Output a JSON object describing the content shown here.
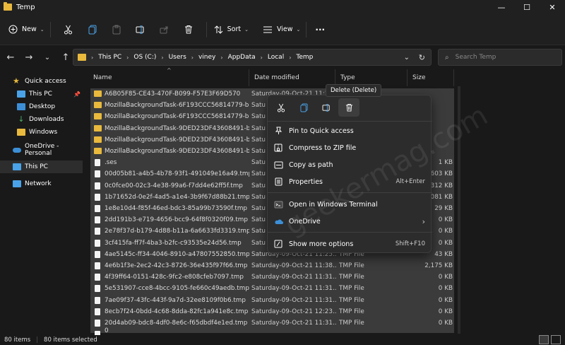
{
  "window": {
    "title": "Temp",
    "min": "—",
    "max": "☐",
    "close": "✕"
  },
  "toolbar": {
    "new_label": "New",
    "sort_label": "Sort",
    "view_label": "View",
    "more": "···"
  },
  "address": {
    "segments": [
      "This PC",
      "OS (C:)",
      "Users",
      "viney",
      "AppData",
      "Local",
      "Temp"
    ],
    "search_placeholder": "Search Temp"
  },
  "nav": {
    "items": [
      {
        "label": "Quick access",
        "icon": "star-icon"
      },
      {
        "label": "This PC",
        "icon": "pc-icon"
      },
      {
        "label": "Desktop",
        "icon": "desktop-icon"
      },
      {
        "label": "Downloads",
        "icon": "download-icon"
      },
      {
        "label": "Windows",
        "icon": "folder-icon"
      },
      {
        "label": "OneDrive - Personal",
        "icon": "cloud-icon"
      },
      {
        "label": "This PC",
        "icon": "pc-icon"
      },
      {
        "label": "Network",
        "icon": "network-icon"
      }
    ]
  },
  "columns": {
    "name": "Name",
    "date": "Date modified",
    "type": "Type",
    "size": "Size"
  },
  "rows": [
    {
      "name": "A6B05F85-CE43-470F-B099-F57E3F69D570",
      "date": "Saturday-09-Oct-21 11:38",
      "type": "",
      "size": "",
      "folder": true
    },
    {
      "name": "MozillaBackgroundTask-6F193CCC56814779-b...",
      "date": "Satu",
      "type": "",
      "size": "",
      "folder": true
    },
    {
      "name": "MozillaBackgroundTask-6F193CCC56814779-b...",
      "date": "Satu",
      "type": "",
      "size": "",
      "folder": true
    },
    {
      "name": "MozillaBackgroundTask-9DED23DF43608491-b...",
      "date": "Satu",
      "type": "",
      "size": "",
      "folder": true
    },
    {
      "name": "MozillaBackgroundTask-9DED23DF43608491-b...",
      "date": "Satu",
      "type": "",
      "size": "",
      "folder": true
    },
    {
      "name": "MozillaBackgroundTask-9DED23DF43608491-b...",
      "date": "Satu",
      "type": "",
      "size": "",
      "folder": true
    },
    {
      "name": ".ses",
      "date": "Satu",
      "type": "",
      "size": "1 KB",
      "folder": false
    },
    {
      "name": "00d05b81-a4b5-4b78-93f1-491049e16a49.tmp",
      "date": "Satu",
      "type": "",
      "size": "603 KB",
      "folder": false
    },
    {
      "name": "0c0fce00-02c3-4e38-99a6-f7dd4e62ff5f.tmp",
      "date": "Satu",
      "type": "",
      "size": "312 KB",
      "folder": false
    },
    {
      "name": "1b71652d-0e2f-4ad5-a1e4-3b9f67d88b21.tmp",
      "date": "Satu",
      "type": "",
      "size": "081 KB",
      "folder": false
    },
    {
      "name": "1e8e10d4-f85f-46ed-bdc3-85a99b73590f.tmp",
      "date": "Satu",
      "type": "",
      "size": "29 KB",
      "folder": false
    },
    {
      "name": "2dd191b3-e719-4656-bcc9-64f8f0320f09.tmp",
      "date": "Satu",
      "type": "",
      "size": "0 KB",
      "folder": false
    },
    {
      "name": "2e78f37d-b179-4d88-b11a-6a6633fd3319.tmp",
      "date": "Satu",
      "type": "",
      "size": "0 KB",
      "folder": false
    },
    {
      "name": "3cf415fa-ff7f-4ba3-b2fc-c93535e24d56.tmp",
      "date": "Satu",
      "type": "",
      "size": "0 KB",
      "folder": false
    },
    {
      "name": "4ae5145c-ff34-4046-8910-a47807552850.tmp",
      "date": "Saturday-09-Oct-21 11:25...",
      "type": "TMP File",
      "size": "43 KB",
      "folder": false
    },
    {
      "name": "4e6b1f3e-2ec2-42c3-8726-36e435f97f66.tmp",
      "date": "Saturday-09-Oct-21 11:38...",
      "type": "TMP File",
      "size": "2,175 KB",
      "folder": false
    },
    {
      "name": "4f39ff64-0151-428c-9fc2-e808cfeb7097.tmp",
      "date": "Saturday-09-Oct-21 11:31...",
      "type": "TMP File",
      "size": "0 KB",
      "folder": false
    },
    {
      "name": "5e531907-cce8-4bcc-9105-fe660c49aedb.tmp",
      "date": "Saturday-09-Oct-21 11:31...",
      "type": "TMP File",
      "size": "0 KB",
      "folder": false
    },
    {
      "name": "7ae09f37-43fc-443f-9a7d-32ee8109f0b6.tmp",
      "date": "Saturday-09-Oct-21 11:31...",
      "type": "TMP File",
      "size": "0 KB",
      "folder": false
    },
    {
      "name": "8ecb7f24-0bdd-4c68-8dda-82fc1a941e8c.tmp",
      "date": "Saturday-09-Oct-21 12:23...",
      "type": "TMP File",
      "size": "0 KB",
      "folder": false
    },
    {
      "name": "20d4ab09-bdc8-4df0-8e6c-f65dbdf4e1ed.tmp",
      "date": "Saturday-09-Oct-21 11:31...",
      "type": "TMP File",
      "size": "0 KB",
      "folder": false
    },
    {
      "name": "0",
      "date": "",
      "type": "",
      "size": "",
      "folder": false
    }
  ],
  "tooltip": "Delete (Delete)",
  "context_menu": {
    "items": [
      {
        "label": "Pin to Quick access",
        "shortcut": "",
        "icon": "pin-icon"
      },
      {
        "label": "Compress to ZIP file",
        "shortcut": "",
        "icon": "zip-icon"
      },
      {
        "label": "Copy as path",
        "shortcut": "",
        "icon": "copy-path-icon"
      },
      {
        "label": "Properties",
        "shortcut": "Alt+Enter",
        "icon": "properties-icon"
      },
      {
        "label": "Open in Windows Terminal",
        "shortcut": "",
        "icon": "terminal-icon"
      },
      {
        "label": "OneDrive",
        "shortcut": "›",
        "icon": "cloud-icon"
      },
      {
        "label": "Show more options",
        "shortcut": "Shift+F10",
        "icon": "more-options-icon"
      }
    ]
  },
  "status": {
    "count": "80 items",
    "selected": "80 items selected"
  },
  "watermark": "geekermag.com",
  "colors": {
    "folder": "#e8b93d",
    "background": "#191919",
    "selection": "#3b3b3b",
    "menu": "#2c2c2c"
  }
}
